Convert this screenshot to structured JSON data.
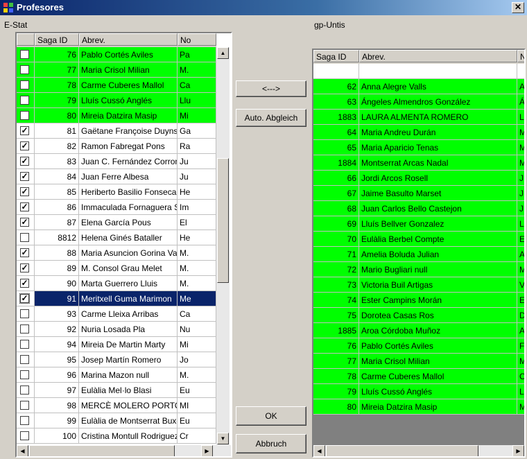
{
  "window": {
    "title": "Profesores"
  },
  "left": {
    "caption": "E-Stat",
    "columns": [
      "Saga ID",
      "Abrev.",
      "No"
    ],
    "rows": [
      {
        "id": "76",
        "abrev": "Pablo Cortés Aviles",
        "nc": "Pa",
        "checked": false,
        "green": true,
        "sel": false
      },
      {
        "id": "77",
        "abrev": "Maria Crisol Milian",
        "nc": "M.",
        "checked": false,
        "green": true,
        "sel": false
      },
      {
        "id": "78",
        "abrev": "Carme Cuberes Mallol",
        "nc": "Ca",
        "checked": false,
        "green": true,
        "sel": false
      },
      {
        "id": "79",
        "abrev": "Lluís Cussó Anglés",
        "nc": "Llu",
        "checked": false,
        "green": true,
        "sel": false
      },
      {
        "id": "80",
        "abrev": "Mireia Datzira Masip",
        "nc": "Mi",
        "checked": false,
        "green": true,
        "sel": false
      },
      {
        "id": "81",
        "abrev": "Gaëtane Françoise Duyns",
        "nc": "Ga",
        "checked": true,
        "green": false,
        "sel": false
      },
      {
        "id": "82",
        "abrev": "Ramon Fabregat Pons",
        "nc": "Ra",
        "checked": true,
        "green": false,
        "sel": false
      },
      {
        "id": "83",
        "abrev": "Juan C. Fernández Corron",
        "nc": "Ju",
        "checked": true,
        "green": false,
        "sel": false
      },
      {
        "id": "84",
        "abrev": "Juan Ferre Albesa",
        "nc": "Ju",
        "checked": true,
        "green": false,
        "sel": false
      },
      {
        "id": "85",
        "abrev": "Heriberto Basilio Fonseca",
        "nc": "He",
        "checked": true,
        "green": false,
        "sel": false
      },
      {
        "id": "86",
        "abrev": "Immaculada Fornaguera S",
        "nc": "Im",
        "checked": true,
        "green": false,
        "sel": false
      },
      {
        "id": "87",
        "abrev": "Elena García Pous",
        "nc": "El",
        "checked": true,
        "green": false,
        "sel": false
      },
      {
        "id": "8812",
        "abrev": "Helena Ginés Bataller",
        "nc": "He",
        "checked": false,
        "green": false,
        "sel": false
      },
      {
        "id": "88",
        "abrev": "Maria Asuncion Gorina Va",
        "nc": "M.",
        "checked": true,
        "green": false,
        "sel": false
      },
      {
        "id": "89",
        "abrev": "M. Consol Grau Melet",
        "nc": "M.",
        "checked": true,
        "green": false,
        "sel": false
      },
      {
        "id": "90",
        "abrev": "Marta Guerrero Lluis",
        "nc": "M.",
        "checked": true,
        "green": false,
        "sel": false
      },
      {
        "id": "91",
        "abrev": "Meritxell Guma Marimon",
        "nc": "Me",
        "checked": true,
        "green": false,
        "sel": true
      },
      {
        "id": "93",
        "abrev": "Carme Lleixa Arribas",
        "nc": "Ca",
        "checked": false,
        "green": false,
        "sel": false
      },
      {
        "id": "92",
        "abrev": "Nuria Losada Pla",
        "nc": "Nu",
        "checked": false,
        "green": false,
        "sel": false
      },
      {
        "id": "94",
        "abrev": "Mireia De Martin Marty",
        "nc": "Mi",
        "checked": false,
        "green": false,
        "sel": false
      },
      {
        "id": "95",
        "abrev": "Josep Martín Romero",
        "nc": "Jo",
        "checked": false,
        "green": false,
        "sel": false
      },
      {
        "id": "96",
        "abrev": "Marina Mazon null",
        "nc": "M.",
        "checked": false,
        "green": false,
        "sel": false
      },
      {
        "id": "97",
        "abrev": "Eulàlia Mel·lo Blasi",
        "nc": "Eu",
        "checked": false,
        "green": false,
        "sel": false
      },
      {
        "id": "98",
        "abrev": "MERCÈ MOLERO PORTO",
        "nc": "MI",
        "checked": false,
        "green": false,
        "sel": false
      },
      {
        "id": "99",
        "abrev": "Eulàlia de Montserrat Buxó",
        "nc": "Eu",
        "checked": false,
        "green": false,
        "sel": false
      },
      {
        "id": "100",
        "abrev": "Cristina Montull Rodriguez",
        "nc": "Cr",
        "checked": false,
        "green": false,
        "sel": false
      }
    ]
  },
  "right": {
    "caption": "gp-Untis",
    "columns": [
      "Saga ID",
      "Abrev.",
      "N"
    ],
    "rows": [
      {
        "id": "",
        "abrev": "",
        "nc": "",
        "green": false
      },
      {
        "id": "62",
        "abrev": "Anna Alegre Valls",
        "nc": "A",
        "green": true
      },
      {
        "id": "63",
        "abrev": "Ángeles Almendros González",
        "nc": "Á",
        "green": true
      },
      {
        "id": "1883",
        "abrev": "LAURA ALMENTA ROMERO",
        "nc": "L",
        "green": true
      },
      {
        "id": "64",
        "abrev": "Maria Andreu Durán",
        "nc": "M",
        "green": true
      },
      {
        "id": "65",
        "abrev": "Maria Aparicio Tenas",
        "nc": "M",
        "green": true
      },
      {
        "id": "1884",
        "abrev": "Montserrat Arcas Nadal",
        "nc": "M",
        "green": true
      },
      {
        "id": "66",
        "abrev": "Jordi Arcos Rosell",
        "nc": "J",
        "green": true
      },
      {
        "id": "67",
        "abrev": "Jaime Basulto Marset",
        "nc": "J",
        "green": true
      },
      {
        "id": "68",
        "abrev": "Juan Carlos Bello Castejon",
        "nc": "J",
        "green": true
      },
      {
        "id": "69",
        "abrev": "Lluís Bellver Gonzalez",
        "nc": "L",
        "green": true
      },
      {
        "id": "70",
        "abrev": "Eulàlia Berbel Compte",
        "nc": "E",
        "green": true
      },
      {
        "id": "71",
        "abrev": "Amelia Boluda Julian",
        "nc": "A",
        "green": true
      },
      {
        "id": "72",
        "abrev": "Mario Bugliari null",
        "nc": "M",
        "green": true
      },
      {
        "id": "73",
        "abrev": "Victoria Buil Artigas",
        "nc": "V",
        "green": true
      },
      {
        "id": "74",
        "abrev": "Ester Campins Morán",
        "nc": "E",
        "green": true
      },
      {
        "id": "75",
        "abrev": "Dorotea Casas Ros",
        "nc": "D",
        "green": true
      },
      {
        "id": "1885",
        "abrev": "Aroa Córdoba Muñoz",
        "nc": "A",
        "green": true
      },
      {
        "id": "76",
        "abrev": "Pablo Cortés Aviles",
        "nc": "F",
        "green": true
      },
      {
        "id": "77",
        "abrev": "Maria Crisol Milian",
        "nc": "M",
        "green": true
      },
      {
        "id": "78",
        "abrev": "Carme Cuberes Mallol",
        "nc": "C",
        "green": true
      },
      {
        "id": "79",
        "abrev": "Lluís Cussó Anglés",
        "nc": "L",
        "green": true
      },
      {
        "id": "80",
        "abrev": "Mireia Datzira Masip",
        "nc": "M",
        "green": true
      }
    ]
  },
  "buttons": {
    "swap": "<--->",
    "auto": "Auto. Abgleich",
    "ok": "OK",
    "cancel": "Abbruch"
  },
  "colors": {
    "match": "#00ff00",
    "selection": "#0a246a",
    "face": "#d4d0c8"
  }
}
